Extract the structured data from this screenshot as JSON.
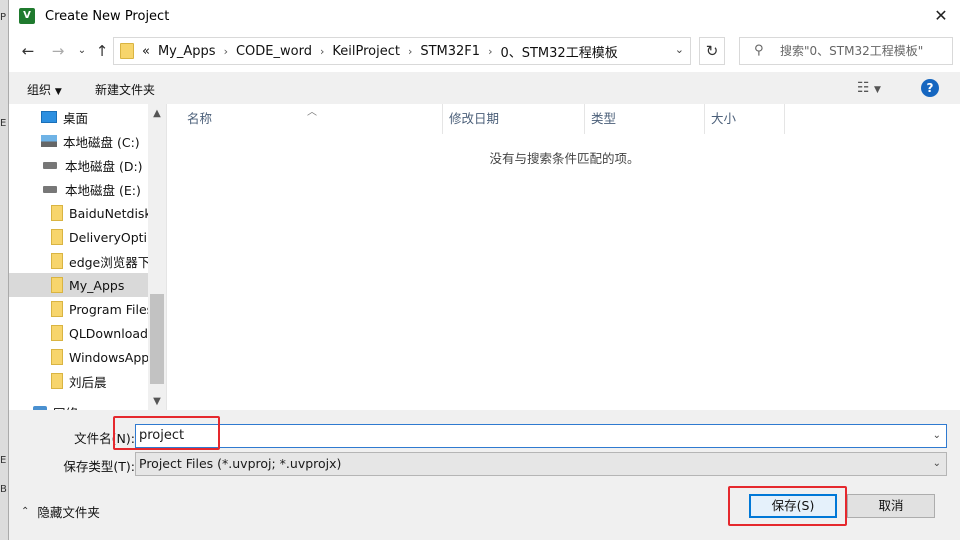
{
  "window": {
    "title": "Create New Project",
    "app_icon": "keil-uvision-icon"
  },
  "background_left": [
    "P",
    "E",
    "E",
    "B"
  ],
  "address_bar": {
    "crumbs": [
      "My_Apps",
      "CODE_word",
      "KeilProject",
      "STM32F1",
      "0、STM32工程模板"
    ],
    "overflow": "«",
    "search_placeholder": "搜索\"0、STM32工程模板\""
  },
  "toolbar": {
    "organize": "组织",
    "new_folder": "新建文件夹"
  },
  "nav_pane": {
    "items": [
      {
        "label": "桌面",
        "icon": "desktop-icon"
      },
      {
        "label": "本地磁盘 (C:)",
        "icon": "system-drive-icon"
      },
      {
        "label": "本地磁盘 (D:)",
        "icon": "drive-icon"
      },
      {
        "label": "本地磁盘 (E:)",
        "icon": "drive-icon"
      },
      {
        "label": "BaiduNetdisk",
        "icon": "folder-icon"
      },
      {
        "label": "DeliveryOptim",
        "icon": "folder-icon"
      },
      {
        "label": "edge浏览器下",
        "icon": "folder-icon"
      },
      {
        "label": "My_Apps",
        "icon": "folder-icon",
        "selected": true
      },
      {
        "label": "Program Files",
        "icon": "folder-icon"
      },
      {
        "label": "QLDownloadC",
        "icon": "folder-icon"
      },
      {
        "label": "WindowsApp",
        "icon": "folder-icon"
      },
      {
        "label": "刘后晨",
        "icon": "folder-icon"
      },
      {
        "label": "网络",
        "icon": "network-icon"
      }
    ]
  },
  "file_list": {
    "columns": [
      "名称",
      "修改日期",
      "类型",
      "大小"
    ],
    "empty_message": "没有与搜索条件匹配的项。"
  },
  "form": {
    "filename_label": "文件名(N):",
    "filename_value": "project",
    "filetype_label": "保存类型(T):",
    "filetype_value": "Project Files (*.uvproj; *.uvprojx)"
  },
  "footer": {
    "hide_folders": "隐藏文件夹",
    "save_button": "保存(S)",
    "cancel_button": "取消"
  },
  "colors": {
    "highlight_annotation": "#e5282d",
    "accent": "#0078d7"
  }
}
